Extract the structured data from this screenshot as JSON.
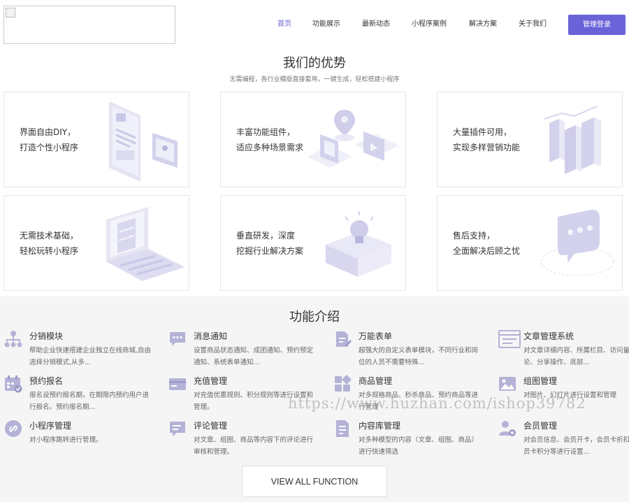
{
  "header": {
    "logo_alt": "",
    "nav": [
      {
        "label": "首页",
        "active": true
      },
      {
        "label": "功能展示"
      },
      {
        "label": "最新动态"
      },
      {
        "label": "小程序案例"
      },
      {
        "label": "解决方案"
      },
      {
        "label": "关于我们"
      }
    ],
    "login_label": "管理登录"
  },
  "advantages": {
    "title": "我们的优势",
    "subtitle": "无需编程，各行业模版直接套用，一键生成，轻松搭建小程序",
    "cards": [
      {
        "line1": "界面自由DIY，",
        "line2": "打造个性小程序",
        "icon": "phone-ui-illustration"
      },
      {
        "line1": "丰富功能组件，",
        "line2": "适应多种场景需求",
        "icon": "components-illustration"
      },
      {
        "line1": "大量插件可用，",
        "line2": "实现多样营销功能",
        "icon": "bar-chart-illustration"
      },
      {
        "line1": "无需技术基础，",
        "line2": "轻松玩转小程序",
        "icon": "laptop-illustration"
      },
      {
        "line1": "垂直研发，深度",
        "line2": "挖掘行业解决方案",
        "icon": "lightbulb-illustration"
      },
      {
        "line1": "售后支持，",
        "line2": "全面解决后顾之忧",
        "icon": "chat-bubble-illustration"
      }
    ]
  },
  "features": {
    "title": "功能介绍",
    "items": [
      {
        "title": "分销模块",
        "desc": "帮助企业快速搭建企业独立在线商城,自由选择分销模式,从多...",
        "icon": "distribution-icon"
      },
      {
        "title": "消息通知",
        "desc": "设置商品状态通知、成团通知、预约预定通知、系统表单通知...",
        "icon": "message-icon"
      },
      {
        "title": "万能表单",
        "desc": "超强大的自定义表单模块，不同行业和岗位的人员不需要特殊...",
        "icon": "form-icon"
      },
      {
        "title": "文章管理系统",
        "desc": "对文章详细内容、所属栏目、访问量、评论、分享操作、底部...",
        "icon": "article-icon"
      },
      {
        "title": "预约报名",
        "desc": "报名设预约报名期，在期限内预约用户进行报名。预约报名期...",
        "icon": "calendar-icon"
      },
      {
        "title": "充值管理",
        "desc": "对充值优惠规则、积分规则等进行设置和管理。",
        "icon": "card-icon"
      },
      {
        "title": "商品管理",
        "desc": "对多规格商品、秒杀商品、预约商品等进行管理",
        "icon": "grid-icon"
      },
      {
        "title": "组图管理",
        "desc": "对图片、幻灯片进行设置和管理",
        "icon": "image-icon"
      },
      {
        "title": "小程序管理",
        "desc": "对小程序跳转进行管理。",
        "icon": "link-icon"
      },
      {
        "title": "评论管理",
        "desc": "对文章、组图、商品等内容下的评论进行审核和管理。",
        "icon": "comment-icon"
      },
      {
        "title": "内容库管理",
        "desc": "对多种模型的内容（文章、组图、商品）进行快速筛选",
        "icon": "document-icon"
      },
      {
        "title": "会员管理",
        "desc": "对会员信息、会员开卡，会员卡折扣，会员卡积分等进行设置...",
        "icon": "member-gear-icon"
      }
    ],
    "view_all_label": "VIEW ALL FUNCTION"
  },
  "watermark": "https://www.huzhan.com/ishop39782",
  "colors": {
    "accent": "#6a62d8",
    "icon": "#b4b2d6",
    "illustration": "#dcdcf0"
  }
}
